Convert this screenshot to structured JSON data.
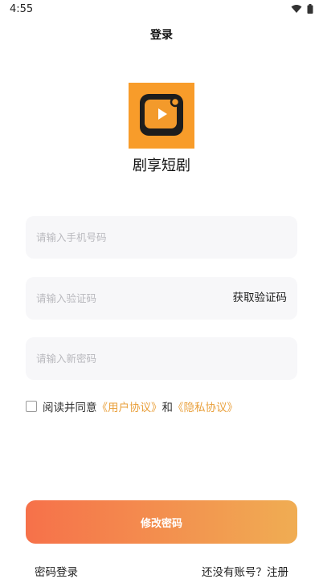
{
  "status_bar": {
    "time": "4:55",
    "icons": [
      "wifi-icon",
      "battery-icon"
    ]
  },
  "header": {
    "title": "登录"
  },
  "app": {
    "name": "剧享短剧",
    "logo_icon": "video-play-icon",
    "logo_color": "#f89c2a"
  },
  "form": {
    "phone_placeholder": "请输入手机号码",
    "code_placeholder": "请输入验证码",
    "get_code_label": "获取验证码",
    "new_password_placeholder": "请输入新密码"
  },
  "agreement": {
    "checked": false,
    "prefix": "阅读并同意",
    "user_agreement": "《用户协议》",
    "and": "和",
    "privacy_agreement": "《隐私协议》",
    "link_color": "#e9a03c"
  },
  "submit": {
    "label": "修改密码",
    "gradient": [
      "#f6714a",
      "#f0ad53"
    ]
  },
  "footer": {
    "password_login": "密码登录",
    "no_account": "还没有账号？",
    "register": "注册"
  }
}
